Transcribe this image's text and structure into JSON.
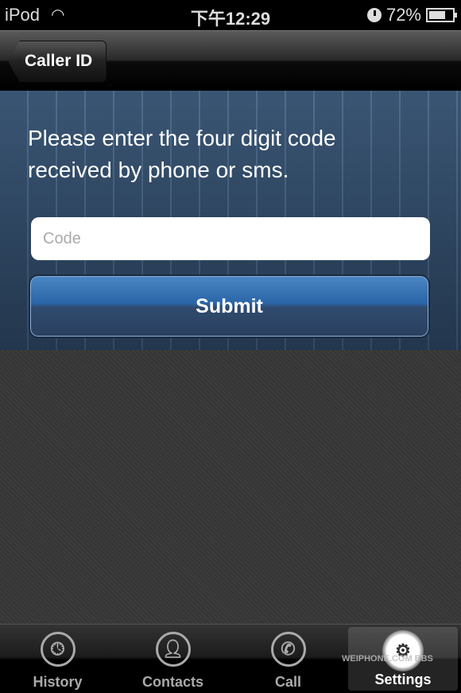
{
  "status": {
    "carrier": "iPod",
    "time": "下午12:29",
    "battery": "72%",
    "battery_level": 0.72
  },
  "nav": {
    "back_label": "Caller ID"
  },
  "main": {
    "prompt": "Please enter the four digit code received by phone or sms.",
    "code_placeholder": "Code",
    "code_value": "",
    "submit_label": "Submit"
  },
  "tabbar": {
    "items": [
      {
        "label": "History",
        "icon": "clock-icon"
      },
      {
        "label": "Contacts",
        "icon": "person-icon"
      },
      {
        "label": "Call",
        "icon": "phone-icon"
      },
      {
        "label": "Settings",
        "icon": "gear-icon",
        "selected": true
      }
    ]
  },
  "watermark": "WEIPHONE.COM BBS"
}
